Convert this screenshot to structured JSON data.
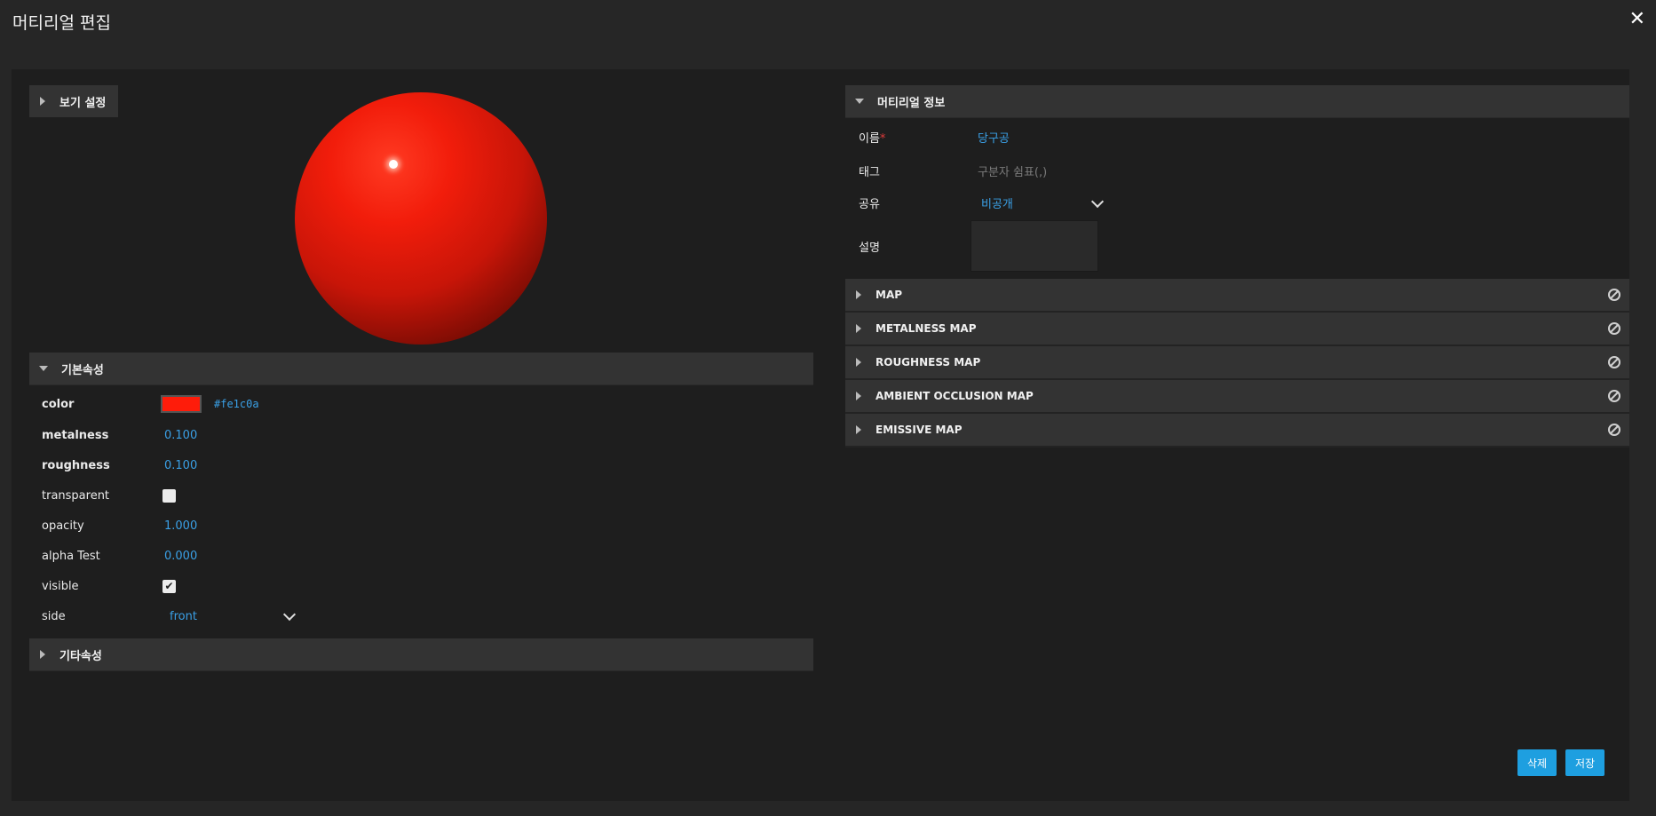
{
  "window": {
    "title": "머티리얼 편집",
    "close_glyph": "✕"
  },
  "view": {
    "label": "보기 설정"
  },
  "basic": {
    "header": "기본속성",
    "color_label": "color",
    "color_hex": "#fe1c0a",
    "metalness_label": "metalness",
    "metalness": "0.100",
    "roughness_label": "roughness",
    "roughness": "0.100",
    "transparent_label": "transparent",
    "transparent_checked": false,
    "opacity_label": "opacity",
    "opacity": "1.000",
    "alpha_test_label": "alpha Test",
    "alpha_test": "0.000",
    "visible_label": "visible",
    "visible_checked": true,
    "side_label": "side",
    "side": "front"
  },
  "other": {
    "header": "기타속성"
  },
  "info": {
    "header": "머티리얼 정보",
    "name_label": "이름",
    "required_mark": "*",
    "name_value": "당구공",
    "tag_label": "태그",
    "tag_placeholder": "구분자 쉼표(,)",
    "share_label": "공유",
    "share_value": "비공개",
    "desc_label": "설명"
  },
  "maps": [
    {
      "label": "MAP"
    },
    {
      "label": "METALNESS MAP"
    },
    {
      "label": "ROUGHNESS MAP"
    },
    {
      "label": "AMBIENT OCCLUSION MAP"
    },
    {
      "label": "EMISSIVE MAP"
    }
  ],
  "buttons": {
    "delete": "삭제",
    "save": "저장"
  },
  "colors": {
    "accent": "#1e9fe0",
    "value_text": "#3aa0e6",
    "material": "#fe1c0a"
  },
  "icons": {
    "map_clear": "ban-icon",
    "close": "close-icon"
  }
}
